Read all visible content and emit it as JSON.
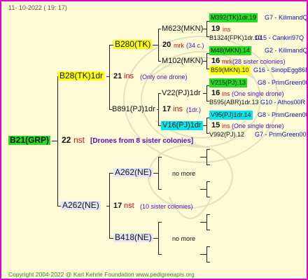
{
  "date": "11- 10-2022 ( 19: 17)",
  "copyright": "Copyright 2004-2022 @ Karl Kehrle Foundation   www.pedigreeapis.org",
  "colors": {
    "border": "#e000c8",
    "background": "#fffbd6",
    "green": "#22dd22",
    "yellow": "#ffff00",
    "cyan": "#00e8f0",
    "lavender": "#e6e6f6"
  },
  "root": {
    "id": "B21(GRP)",
    "count": "22",
    "unit": "nst",
    "note": "[Drones from 8 sister colonies]"
  },
  "sire": {
    "id": "B28(TK)1dr",
    "count": "21",
    "unit": "ins",
    "note": "(Only one drone)"
  },
  "dam": {
    "id": "A262(NE)",
    "count": "17",
    "unit": "nst",
    "note": "(10 sister colonies)"
  },
  "ss": {
    "id": "B280(TK)",
    "count": "20",
    "unit": "mrk",
    "note": "(34 c.)"
  },
  "sd": {
    "id": "B891(PJ)1dr",
    "count": "17",
    "unit": "ins",
    "note": "(1dr.)"
  },
  "ds": {
    "id": "A262(NE)",
    "more": "no more"
  },
  "dd": {
    "id": "B418(NE)",
    "more": "no more"
  },
  "sss": {
    "id": "M623(MKN)",
    "count": "19",
    "unit": "ins"
  },
  "ssd": {
    "id": "M102(MKN)",
    "count": "16",
    "unit": "mrk",
    "note": "(28 sister colonies)"
  },
  "sds": {
    "id": "V22(PJ)1dr",
    "count": "16",
    "unit": "ins",
    "note": "(One single drone)"
  },
  "sdd": {
    "id": "V16(PJ)1dr",
    "count": "15",
    "unit": "ins",
    "note": "(One single drone)"
  },
  "g4": [
    {
      "id": "M392(TK)1dr.19",
      "line": "G7 - KilimandQ"
    },
    {
      "id": "B1324(FPK)1dr.10",
      "line": "G15 - Cankiri97Q"
    },
    {
      "id": "M48(MKN).14",
      "line": "G2 - KilimandQ"
    },
    {
      "id": "B59(MKN).10",
      "line": "G16 - SinopEgg86R"
    },
    {
      "id": "V215(PJ).13",
      "line": "G8 - PrimGreen00"
    },
    {
      "id": "B595(ABR)1dr.13",
      "line": "G10 - Athos00R"
    },
    {
      "id": "V95(PJ)1dr.14",
      "line": "G8 - PrimGreen00"
    },
    {
      "id": "V992(PJ).12",
      "line": "G7 - PrimGreen00"
    }
  ]
}
